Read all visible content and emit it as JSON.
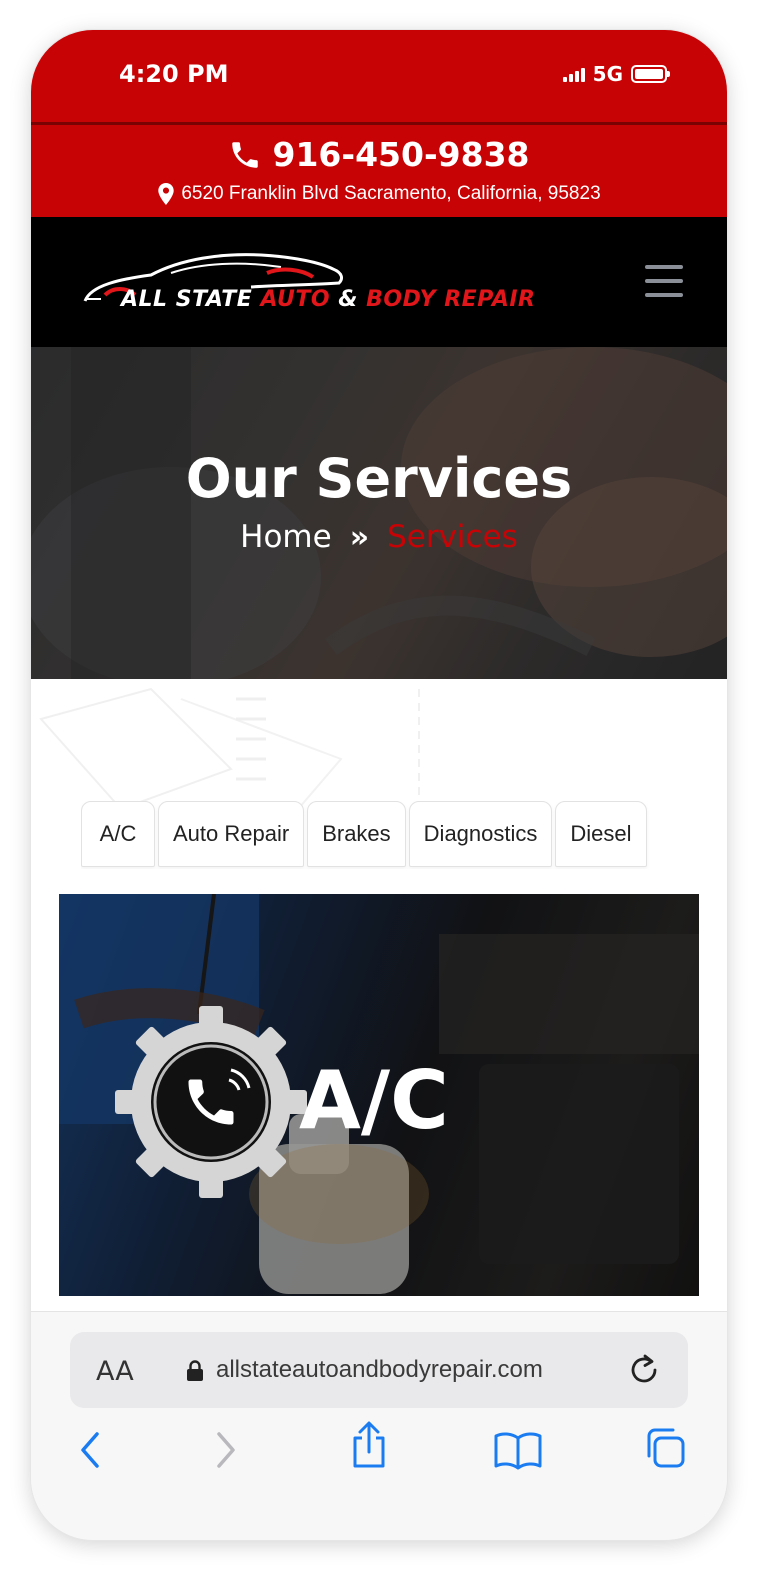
{
  "status_bar": {
    "time": "4:20 PM",
    "network": "5G"
  },
  "contact": {
    "phone": "916-450-9838",
    "address": "6520 Franklin Blvd Sacramento, California, 95823"
  },
  "logo": {
    "part1": "ALL STATE ",
    "part2": "AUTO ",
    "part3": "& ",
    "part4": "BODY REPAIR"
  },
  "hero": {
    "title": "Our Services",
    "breadcrumb_home": "Home",
    "breadcrumb_current": "Services"
  },
  "tabs": [
    "A/C",
    "Auto Repair",
    "Brakes",
    "Diagnostics",
    "Diesel"
  ],
  "service_card": {
    "title": "A/C"
  },
  "browser": {
    "text_size_label": "AA",
    "url": "allstateautoandbodyrepair.com"
  },
  "colors": {
    "brand_red": "#c80306",
    "nav_black": "#000000",
    "link_blue": "#1a7cf0"
  }
}
